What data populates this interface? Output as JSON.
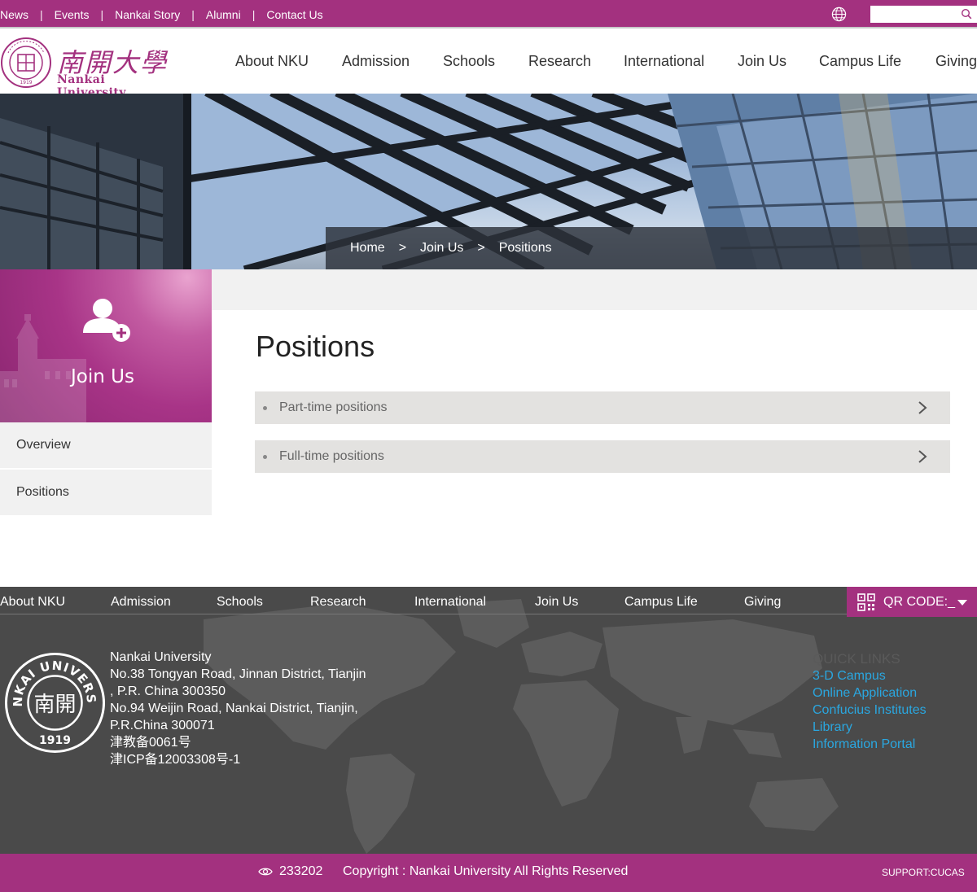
{
  "colors": {
    "brand": "#a3317f",
    "footer_bg": "#4a4a4a",
    "link_blue": "#2aa7e0",
    "item_bg": "#e3e2e0",
    "side_bg": "#f1f1f1"
  },
  "topbar": {
    "links": [
      "News",
      "Events",
      "Nankai Story",
      "Alumni",
      "Contact Us"
    ],
    "separator": "|",
    "search_placeholder": "",
    "globe_icon": "globe-icon",
    "search_icon": "search-icon"
  },
  "logo": {
    "cn": "南開大學",
    "en": "Nankai University",
    "seal_year": "1919"
  },
  "mainnav": [
    "About NKU",
    "Admission",
    "Schools",
    "Research",
    "International",
    "Join Us",
    "Campus Life",
    "Giving"
  ],
  "breadcrumb": {
    "items": [
      "Home",
      "Join Us",
      "Positions"
    ],
    "separator": ">"
  },
  "sidebar": {
    "title": "Join Us",
    "icon": "user-add-icon",
    "items": [
      "Overview",
      "Positions"
    ]
  },
  "content": {
    "title": "Positions",
    "items": [
      "Part-time positions",
      "Full-time positions"
    ]
  },
  "footer": {
    "nav": [
      "About NKU",
      "Admission",
      "Schools",
      "Research",
      "International",
      "Join Us",
      "Campus Life",
      "Giving"
    ],
    "qr_label": "QR CODE:_",
    "seal_text": "NANKAI UNIVERSITY",
    "seal_year": "1919",
    "seal_cn": "南開",
    "address_lines": [
      "Nankai University",
      "No.38 Tongyan Road, Jinnan District, Tianjin",
      ", P.R. China 300350",
      "No.94 Weijin Road,  Nankai District, Tianjin,",
      "P.R.China  300071",
      "津教备0061号",
      "津ICP备12003308号-1"
    ],
    "quick_links_heading": "QUICK LINKS",
    "quick_links": [
      "3-D Campus",
      "Online Application",
      "Confucius Institutes",
      "Library",
      "Information Portal"
    ]
  },
  "bottombar": {
    "visits": "233202",
    "copyright": "Copyright : Nankai University All Rights Reserved",
    "support": "SUPPORT:CUCAS"
  }
}
